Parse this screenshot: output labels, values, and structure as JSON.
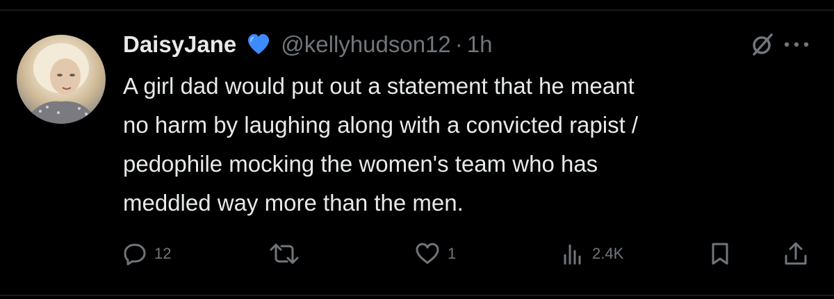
{
  "tweet": {
    "author": {
      "display_name": "DaisyJane",
      "verified_badge_icon": "blue-heart-icon",
      "handle": "@kellyhudson12",
      "separator": "·",
      "timestamp": "1h"
    },
    "text_lines": [
      "A girl dad would put out a statement that he meant",
      "no harm by laughing along with a convicted rapist /",
      "pedophile mocking the women's team who has",
      "meddled way more than the men."
    ],
    "actions": {
      "replies": "12",
      "reposts": "",
      "likes": "1",
      "views": "2.4K"
    },
    "icons": {
      "grok": "grok-icon",
      "more": "more-options-icon",
      "reply": "reply-icon",
      "repost": "repost-icon",
      "like": "heart-icon",
      "views": "views-bar-chart-icon",
      "bookmark": "bookmark-icon",
      "share": "share-icon"
    }
  },
  "colors": {
    "background": "#000000",
    "primary_text": "#e7e9ea",
    "secondary_text": "#71767b",
    "badge_blue": "#3d8bff"
  }
}
